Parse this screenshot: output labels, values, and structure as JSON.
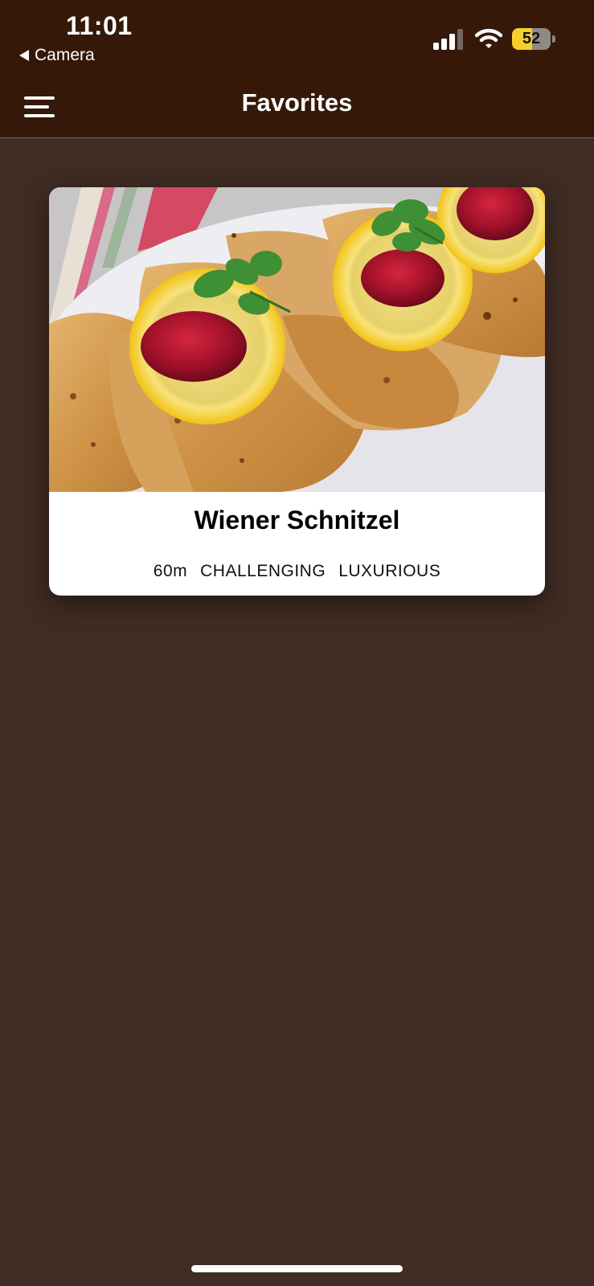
{
  "status_bar": {
    "time": "11:01",
    "back_label": "Camera",
    "battery_level": 52,
    "battery_text": "52"
  },
  "header": {
    "title": "Favorites",
    "menu_icon": "hamburger-menu-icon"
  },
  "favorites": [
    {
      "title": "Wiener Schnitzel",
      "duration": "60m",
      "complexity": "CHALLENGING",
      "affordability": "LUXURIOUS",
      "image": "wiener-schnitzel-photo"
    }
  ],
  "colors": {
    "header_bg": "#351808",
    "screen_bg": "#3f2c23",
    "card_bg": "#ffffff",
    "battery_fill": "#f6cf2a"
  }
}
